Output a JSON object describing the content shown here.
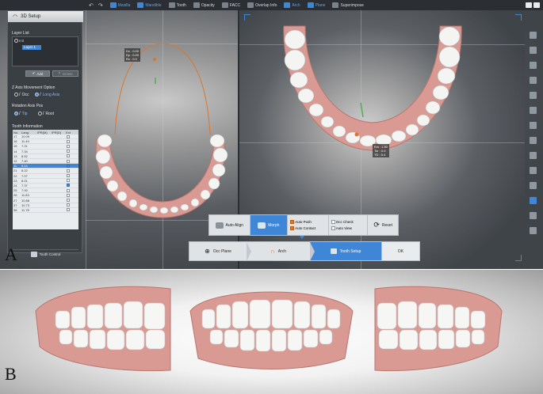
{
  "toolbar": {
    "undo": "↶",
    "redo": "↷",
    "items": [
      {
        "label": "Maxilla",
        "active": true
      },
      {
        "label": "Mandible",
        "active": true
      },
      {
        "label": "Tooth",
        "active": false
      },
      {
        "label": "Opacity",
        "active": false
      },
      {
        "label": "FACC",
        "active": false
      },
      {
        "label": "Overlap Info",
        "active": false
      },
      {
        "label": "Arch",
        "active": true
      },
      {
        "label": "Plane",
        "active": true
      },
      {
        "label": "Superimpose",
        "active": false
      }
    ]
  },
  "left_panel": {
    "title": "3D Setup",
    "layer_list_label": "Layer List",
    "layer_root": "Init",
    "layer_selected": "Layer 1",
    "add_button": "Add",
    "delete_button": "Delete",
    "z_axis_label": "Z Axis Movement Option",
    "z_axis_options": [
      "Occ",
      "Long Axis"
    ],
    "rotation_label": "Rotation Axis Pos",
    "rotation_options": [
      "Tip",
      "Root"
    ],
    "tooth_info_label": "Tooth Information",
    "table_headers": [
      "No.",
      "Lang.",
      "IPR(M)",
      "IPR(D)",
      "Ext"
    ],
    "rows": [
      {
        "no": "17",
        "lang": "10.09",
        "ext": false
      },
      {
        "no": "16",
        "lang": "11.49",
        "ext": false
      },
      {
        "no": "15",
        "lang": "7.21",
        "ext": false
      },
      {
        "no": "14",
        "lang": "7.34",
        "ext": false
      },
      {
        "no": "13",
        "lang": "8.52",
        "ext": false
      },
      {
        "no": "12",
        "lang": "7.40",
        "ext": false
      },
      {
        "no": "11",
        "lang": "9.14",
        "ext": true,
        "selected": true
      },
      {
        "no": "21",
        "lang": "8.22",
        "ext": false
      },
      {
        "no": "22",
        "lang": "7.07",
        "ext": false
      },
      {
        "no": "23",
        "lang": "8.01",
        "ext": false
      },
      {
        "no": "24",
        "lang": "7.37",
        "ext": true
      },
      {
        "no": "25",
        "lang": "7.00",
        "ext": false
      },
      {
        "no": "26",
        "lang": "11.83",
        "ext": false
      },
      {
        "no": "27",
        "lang": "10.88",
        "ext": false
      },
      {
        "no": "37",
        "lang": "10.73",
        "ext": false
      },
      {
        "no": "36",
        "lang": "11.78",
        "ext": false
      }
    ],
    "tooth_control_button": "Tooth Control"
  },
  "action_bar": {
    "auto_align": "Auto Align",
    "morph": "Morph",
    "auto_push": "Auto Push",
    "auto_contact": "Auto Contact",
    "occ_check": "Occ Check",
    "auto_view": "Auto View",
    "reset": "Reset"
  },
  "wizard": {
    "steps": [
      "Occ Plane",
      "Arch",
      "Tooth Setup"
    ],
    "ok": "OK"
  },
  "info_left": [
    "Dx : 0.00",
    "Dy : 0.00",
    "Rx : 0.0"
  ],
  "info_right": [
    "Ext : 1.50",
    "Tor : 0.0",
    "TD : 5.4"
  ],
  "labels": {
    "a": "A",
    "b": "B"
  },
  "colors": {
    "accent": "#3f86d6",
    "gingiva": "#d99a93",
    "tooth": "#f4f4f2"
  }
}
